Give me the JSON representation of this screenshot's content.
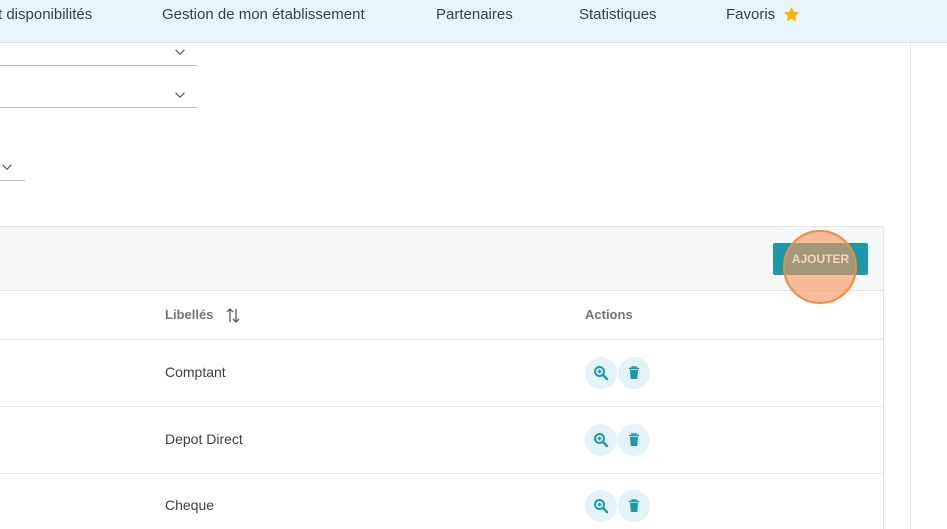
{
  "nav": {
    "items": [
      {
        "label": "t disponibilités"
      },
      {
        "label": "Gestion de mon établissement"
      },
      {
        "label": "Partenaires"
      },
      {
        "label": "Statistiques"
      },
      {
        "label": "Favoris"
      }
    ]
  },
  "toolbar": {
    "add_label": "AJOUTER"
  },
  "table": {
    "columns": [
      {
        "label": "Libellés",
        "sortable": true
      },
      {
        "label": "Actions",
        "sortable": false
      }
    ],
    "rows": [
      {
        "label": "Comptant"
      },
      {
        "label": "Depot Direct"
      },
      {
        "label": "Cheque"
      }
    ]
  },
  "colors": {
    "nav_bg": "#e8f6fb",
    "accent": "#1b9aaa",
    "star": "#f7b500",
    "action_bg": "#e3f3f7",
    "click_marker": "#f08a3c"
  },
  "icons": {
    "favorite": "star-icon",
    "sort": "sort-arrows-icon",
    "view": "zoom-in-icon",
    "delete": "trash-icon",
    "dropdown": "chevron-down-icon"
  }
}
